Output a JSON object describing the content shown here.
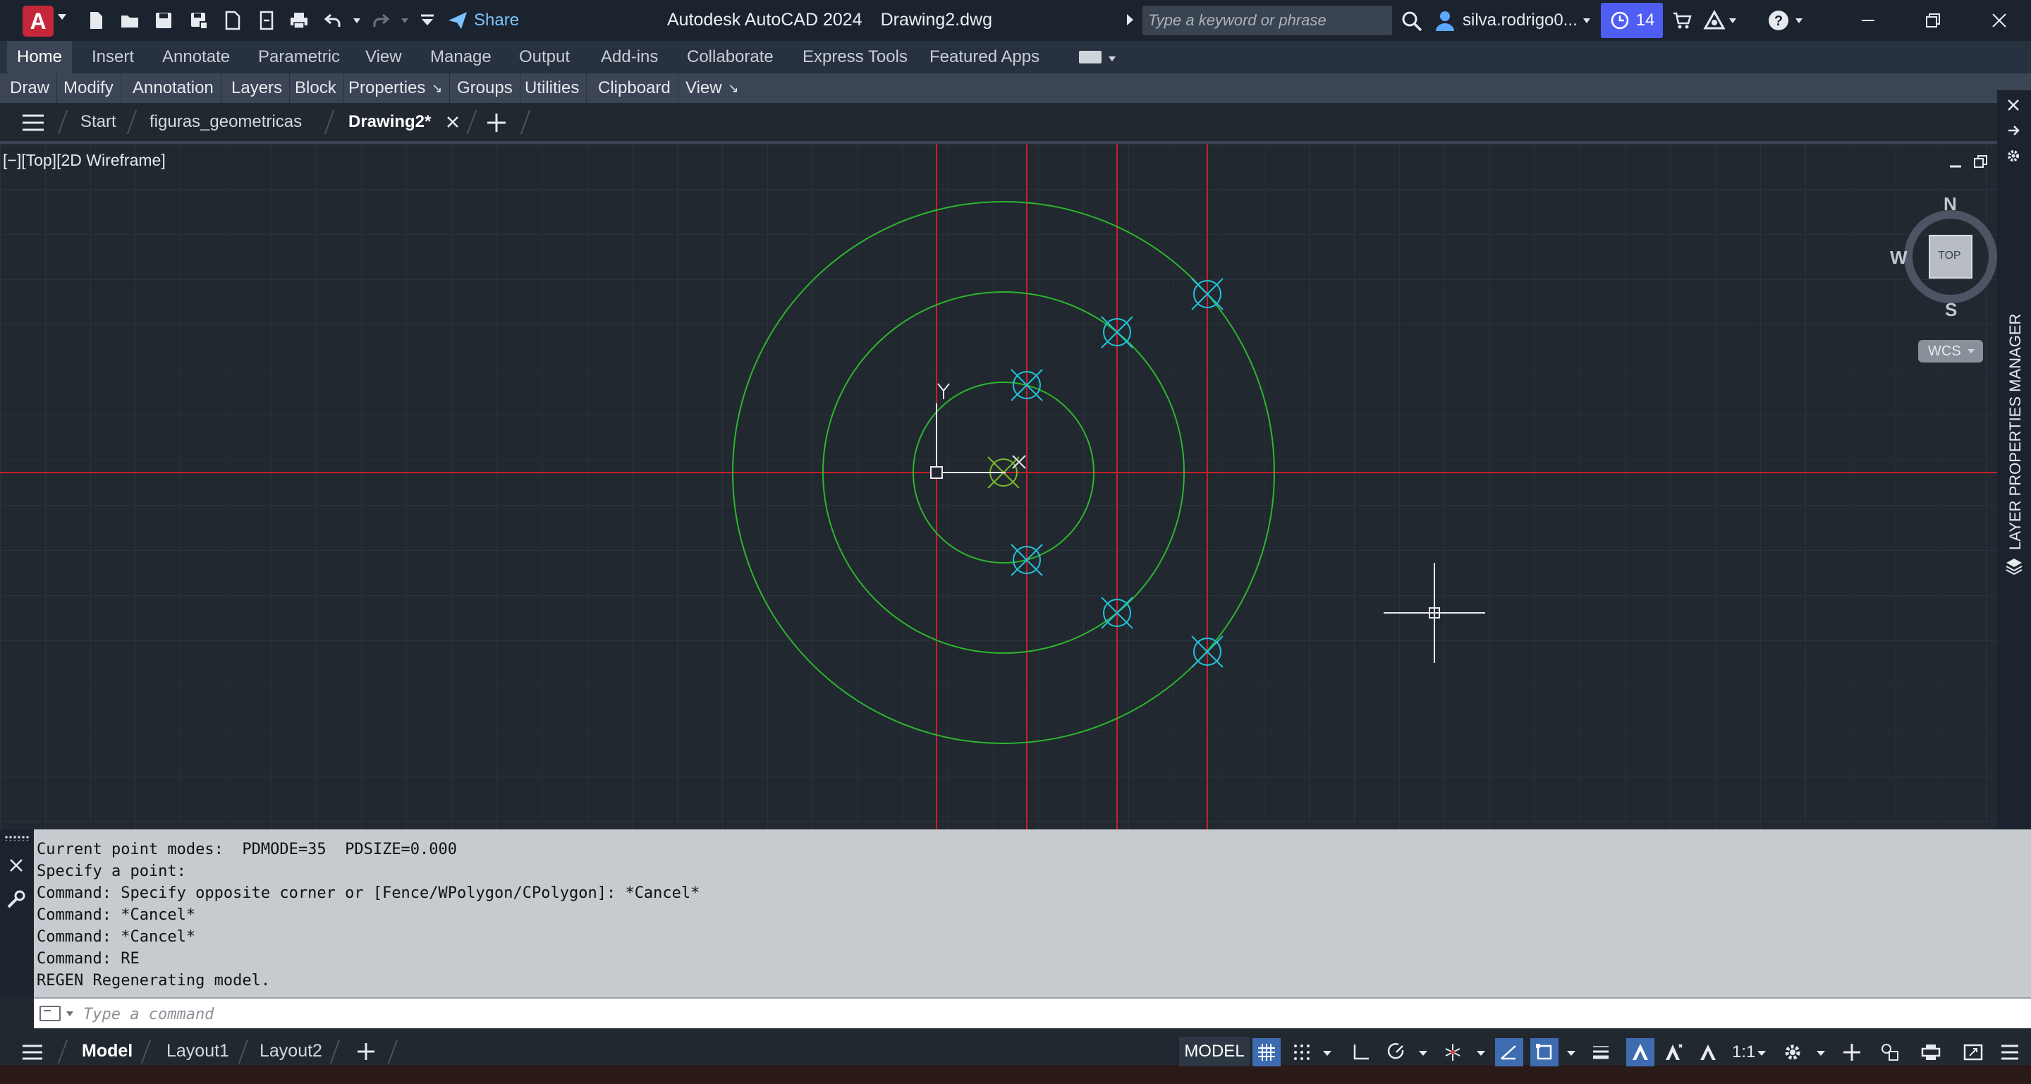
{
  "title_bar": {
    "app_title": "Autodesk AutoCAD 2024",
    "file_name": "Drawing2.dwg",
    "share_label": "Share",
    "search_placeholder": "Type a keyword or phrase",
    "user_name": "silva.rodrigo0...",
    "notification_count": "14"
  },
  "ribbon_tabs": [
    {
      "label": "Home",
      "active": true
    },
    {
      "label": "Insert"
    },
    {
      "label": "Annotate"
    },
    {
      "label": "Parametric"
    },
    {
      "label": "View"
    },
    {
      "label": "Manage"
    },
    {
      "label": "Output"
    },
    {
      "label": "Add-ins"
    },
    {
      "label": "Collaborate"
    },
    {
      "label": "Express Tools"
    },
    {
      "label": "Featured Apps"
    }
  ],
  "panels": [
    "Draw",
    "Modify",
    "Annotation",
    "Layers",
    "Block",
    "Properties",
    "Groups",
    "Utilities",
    "Clipboard",
    "View"
  ],
  "doc_tabs": {
    "start": "Start",
    "file1": "figuras_geometricas",
    "file2": "Drawing2*"
  },
  "viewport": {
    "label": "[−][Top][2D Wireframe]",
    "viewcube": {
      "n": "N",
      "s": "S",
      "w": "W",
      "face": "TOP",
      "ucs": "WCS"
    },
    "side_palette": "LAYER PROPERTIES MANAGER"
  },
  "command_history": [
    "Current point modes:  PDMODE=35  PDSIZE=0.000",
    "Specify a point:",
    "Command: Specify opposite corner or [Fence/WPolygon/CPolygon]: *Cancel*",
    "Command: *Cancel*",
    "Command: *Cancel*",
    "Command: RE",
    "REGEN Regenerating model."
  ],
  "command_placeholder": "Type a command",
  "layouts": {
    "model": "Model",
    "layout1": "Layout1",
    "layout2": "Layout2"
  },
  "status": {
    "model_label": "MODEL",
    "scale": "1:1"
  },
  "colors": {
    "circle": "#2db52d",
    "construction": "#c8202a",
    "point": "#22c3d8",
    "grid": "#2a323d",
    "background": "#212830"
  }
}
